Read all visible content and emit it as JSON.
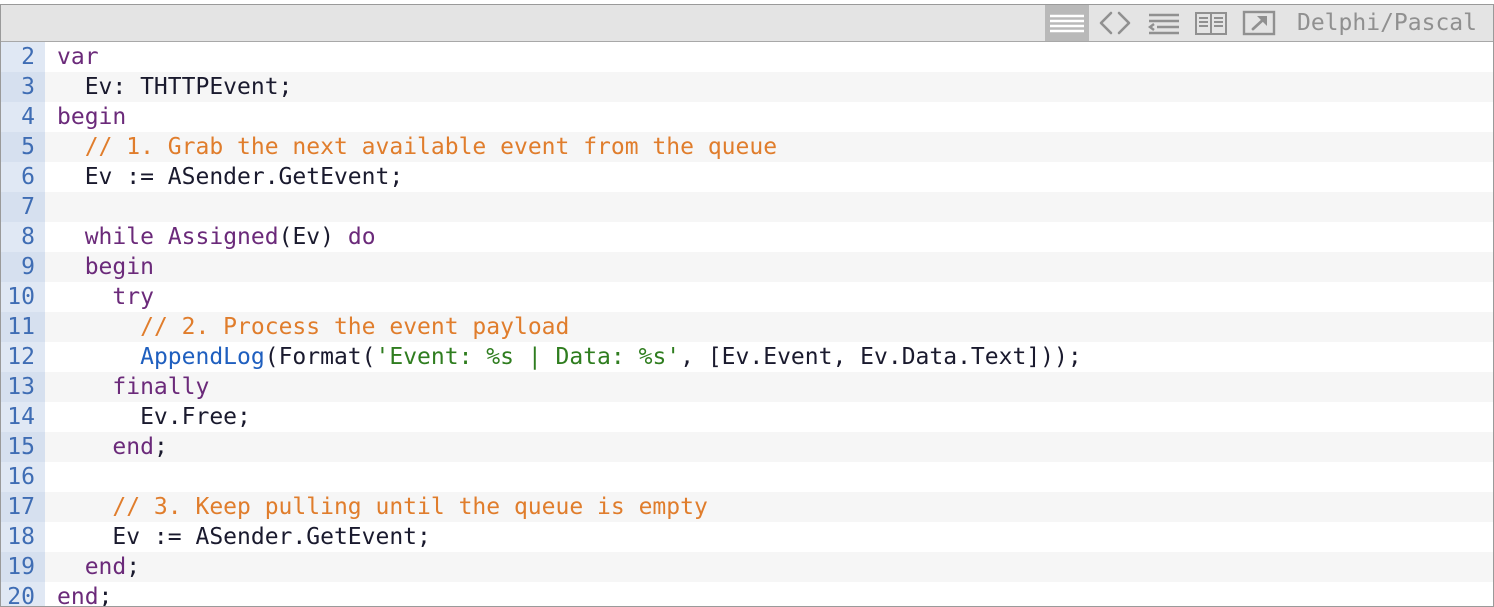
{
  "toolbar": {
    "language": "Delphi/Pascal",
    "buttons": [
      {
        "name": "view-source",
        "icon": "lines-icon"
      },
      {
        "name": "copy",
        "icon": "code-brackets-icon"
      },
      {
        "name": "wrap",
        "icon": "wrap-icon"
      },
      {
        "name": "print",
        "icon": "print-icon"
      },
      {
        "name": "help",
        "icon": "popout-icon"
      }
    ]
  },
  "code": {
    "lines": [
      {
        "n": "2",
        "tokens": [
          {
            "t": "k",
            "v": "var"
          }
        ]
      },
      {
        "n": "3",
        "tokens": [
          {
            "t": "t",
            "v": "  Ev: THTTPEvent;"
          }
        ]
      },
      {
        "n": "4",
        "tokens": [
          {
            "t": "k",
            "v": "begin"
          }
        ]
      },
      {
        "n": "5",
        "tokens": [
          {
            "t": "t",
            "v": "  "
          },
          {
            "t": "c",
            "v": "// 1. Grab the next available event from the queue"
          }
        ]
      },
      {
        "n": "6",
        "tokens": [
          {
            "t": "t",
            "v": "  Ev := ASender.GetEvent;"
          }
        ]
      },
      {
        "n": "7",
        "tokens": []
      },
      {
        "n": "8",
        "tokens": [
          {
            "t": "t",
            "v": "  "
          },
          {
            "t": "k",
            "v": "while"
          },
          {
            "t": "t",
            "v": " "
          },
          {
            "t": "k",
            "v": "Assigned"
          },
          {
            "t": "t",
            "v": "(Ev) "
          },
          {
            "t": "k",
            "v": "do"
          }
        ]
      },
      {
        "n": "9",
        "tokens": [
          {
            "t": "t",
            "v": "  "
          },
          {
            "t": "k",
            "v": "begin"
          }
        ]
      },
      {
        "n": "10",
        "tokens": [
          {
            "t": "t",
            "v": "    "
          },
          {
            "t": "k",
            "v": "try"
          }
        ]
      },
      {
        "n": "11",
        "tokens": [
          {
            "t": "t",
            "v": "      "
          },
          {
            "t": "c",
            "v": "// 2. Process the event payload"
          }
        ]
      },
      {
        "n": "12",
        "tokens": [
          {
            "t": "t",
            "v": "      "
          },
          {
            "t": "f",
            "v": "AppendLog"
          },
          {
            "t": "t",
            "v": "(Format("
          },
          {
            "t": "s",
            "v": "'Event: %s | Data: %s'"
          },
          {
            "t": "t",
            "v": ", [Ev.Event, Ev.Data.Text]));"
          }
        ]
      },
      {
        "n": "13",
        "tokens": [
          {
            "t": "t",
            "v": "    "
          },
          {
            "t": "k",
            "v": "finally"
          }
        ]
      },
      {
        "n": "14",
        "tokens": [
          {
            "t": "t",
            "v": "      Ev.Free;"
          }
        ]
      },
      {
        "n": "15",
        "tokens": [
          {
            "t": "t",
            "v": "    "
          },
          {
            "t": "k",
            "v": "end"
          },
          {
            "t": "t",
            "v": ";"
          }
        ]
      },
      {
        "n": "16",
        "tokens": []
      },
      {
        "n": "17",
        "tokens": [
          {
            "t": "t",
            "v": "    "
          },
          {
            "t": "c",
            "v": "// 3. Keep pulling until the queue is empty"
          }
        ]
      },
      {
        "n": "18",
        "tokens": [
          {
            "t": "t",
            "v": "    Ev := ASender.GetEvent;"
          }
        ]
      },
      {
        "n": "19",
        "tokens": [
          {
            "t": "t",
            "v": "  "
          },
          {
            "t": "k",
            "v": "end"
          },
          {
            "t": "t",
            "v": ";"
          }
        ]
      },
      {
        "n": "20",
        "tokens": [
          {
            "t": "k",
            "v": "end"
          },
          {
            "t": "t",
            "v": ";"
          }
        ]
      }
    ]
  }
}
